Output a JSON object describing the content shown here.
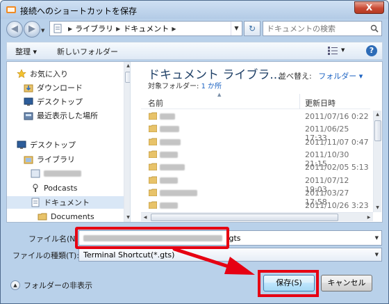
{
  "window": {
    "title": "接続へのショートカットを保存",
    "close_glyph": "X"
  },
  "address": {
    "crumbs": [
      "ライブラリ",
      "ドキュメント"
    ],
    "search_placeholder": "ドキュメントの検索"
  },
  "toolbar": {
    "organize": "整理 ▾",
    "new_folder": "新しいフォルダー"
  },
  "nav": {
    "favorites": "お気に入り",
    "downloads": "ダウンロード",
    "desktop_fav": "デスクトップ",
    "recent": "最近表示した場所",
    "desktop": "デスクトップ",
    "libraries": "ライブラリ",
    "podcasts": "Podcasts",
    "documents_lib": "ドキュメント",
    "documents_folder": "Documents"
  },
  "library": {
    "title": "ドキュメント ライブラ...",
    "sub_label": "対象フォルダー:",
    "sub_link": "1 か所",
    "arrange_label": "並べ替え:",
    "arrange_value": "フォルダー ▾"
  },
  "columns": {
    "name": "名前",
    "date": "更新日時"
  },
  "files": [
    {
      "date": "2011/07/16 0:22"
    },
    {
      "date": "2011/06/25 17:33"
    },
    {
      "date": "2011/11/07 0:47"
    },
    {
      "date": "2011/10/30 21:15"
    },
    {
      "date": "2011/02/05 5:13"
    },
    {
      "date": "2011/07/12 19:03"
    },
    {
      "date": "2011/03/27 17:58"
    },
    {
      "date": "2011/10/26 3:23"
    }
  ],
  "form": {
    "filename_label": "ファイル名(N):",
    "filename_ext": ".gts",
    "filetype_label": "ファイルの種類(T):",
    "filetype_value": "Terminal Shortcut(*.gts)"
  },
  "footer": {
    "hide_folders": "フォルダーの非表示",
    "save": "保存(S)",
    "cancel": "キャンセル"
  },
  "colors": {
    "annotation": "#e60012",
    "link": "#1b62c2",
    "library_title": "#1e3f66"
  }
}
